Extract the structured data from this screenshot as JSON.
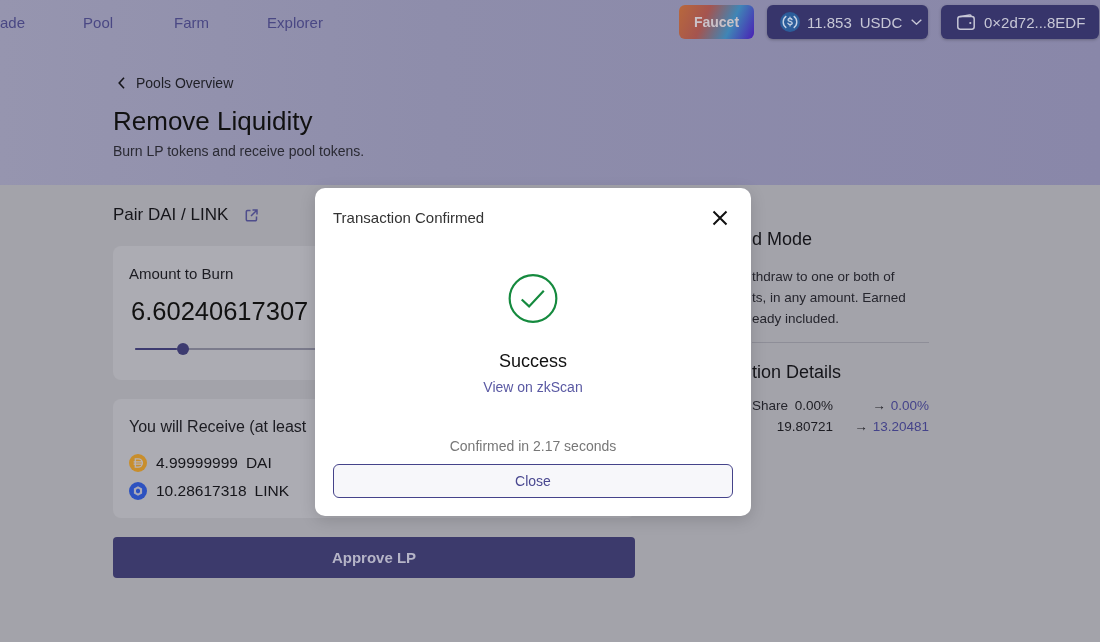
{
  "nav": {
    "links": [
      "ade",
      "Pool",
      "Farm",
      "Explorer"
    ],
    "faucet_button": "Faucet",
    "balance": {
      "amount": "11.853",
      "currency": "USDC"
    },
    "wallet": {
      "address": "0×2d72...8EDF"
    }
  },
  "hero": {
    "back_link": "Pools Overview",
    "title": "Remove Liquidity",
    "subtitle": "Burn LP tokens and receive pool tokens."
  },
  "pair": {
    "title": "Pair DAI / LINK"
  },
  "burn_card": {
    "label": "Amount to Burn",
    "amount": "6.60240617307",
    "slider": {
      "level": 0.1
    }
  },
  "receive_card": {
    "label": "You will Receive (at least",
    "tokens": [
      {
        "kind": "coin",
        "amount": "4.99999999",
        "symbol": "DAI",
        "color": "#c88e2c"
      },
      {
        "kind": "hexagon",
        "amount": "10.28617318",
        "symbol": "LINK",
        "color": "#2d52c0"
      }
    ]
  },
  "approve_button": "Approve LP",
  "side_panel": {
    "mode_title": "d Mode",
    "description_lines": [
      "thdraw to one or both of",
      "ts, in any amount. Earned",
      "eady included."
    ],
    "details_title": "tion Details",
    "details": [
      {
        "label": "Share",
        "from": "0.00%",
        "arrow": "→",
        "to": "0.00%"
      },
      {
        "from": "19.80721",
        "arrow": "→",
        "to": "13.20481"
      }
    ]
  },
  "modal": {
    "title": "Transaction Confirmed",
    "status": "Success",
    "link": "View on zkScan",
    "confirmation": "Confirmed in 2.17 seconds",
    "close_button": "Close"
  }
}
